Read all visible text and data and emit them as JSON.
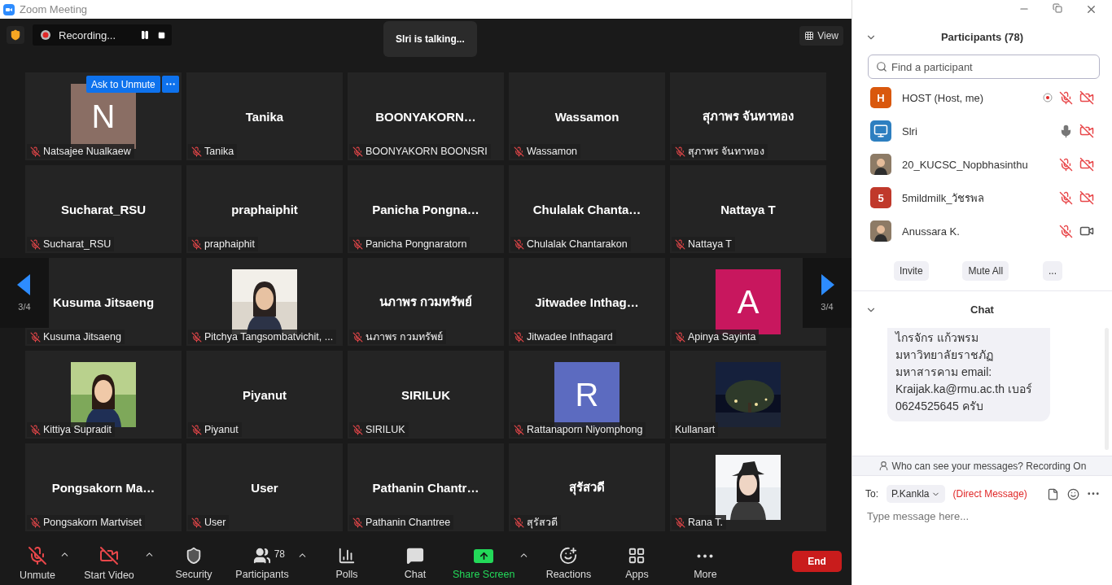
{
  "window": {
    "title": "Zoom Meeting"
  },
  "top_bar": {
    "recording": "Recording...",
    "talking": "Slri is talking...",
    "view_button": "View"
  },
  "tiles": [
    {
      "kind": "letter",
      "letter": "N",
      "color": "#8a6e64",
      "name": "Natsajee Nualkaew",
      "muted": true,
      "hover": {
        "ask_button": "Ask to Unmute"
      }
    },
    {
      "kind": "name",
      "display": "Tanika",
      "name": "Tanika",
      "muted": true
    },
    {
      "kind": "name",
      "display": "BOONYAKORN…",
      "name": "BOONYAKORN BOONSRI",
      "muted": true
    },
    {
      "kind": "name",
      "display": "Wassamon",
      "name": "Wassamon",
      "muted": true
    },
    {
      "kind": "name",
      "display": "สุภาพร จันทาทอง",
      "name": "สุภาพร จันทาทอง",
      "muted": true
    },
    {
      "kind": "name",
      "display": "Sucharat_RSU",
      "name": "Sucharat_RSU",
      "muted": true
    },
    {
      "kind": "name",
      "display": "praphaiphit",
      "name": "praphaiphit",
      "muted": true
    },
    {
      "kind": "name",
      "display": "Panicha  Pongna…",
      "name": "Panicha Pongnaratorn",
      "muted": true
    },
    {
      "kind": "name",
      "display": "Chulalak  Chanta…",
      "name": "Chulalak Chantarakon",
      "muted": true
    },
    {
      "kind": "name",
      "display": "Nattaya T",
      "name": "Nattaya T",
      "muted": true
    },
    {
      "kind": "name",
      "display": "Kusuma Jitsaeng",
      "name": "Kusuma Jitsaeng",
      "muted": true
    },
    {
      "kind": "picture",
      "name": "Pitchya Tangsombatvichit, ...",
      "muted": true
    },
    {
      "kind": "name",
      "display": "นภาพร กวมทรัพย์",
      "name": "นภาพร กวมทรัพย์",
      "muted": true
    },
    {
      "kind": "name",
      "display": "Jitwadee  Inthag…",
      "name": "Jitwadee Inthagard",
      "muted": true
    },
    {
      "kind": "letter",
      "letter": "A",
      "color": "#c8175e",
      "name": "Apinya Sayinta",
      "muted": true
    },
    {
      "kind": "picture",
      "name": "Kittiya Supradit",
      "muted": true
    },
    {
      "kind": "name",
      "display": "Piyanut",
      "name": "Piyanut",
      "muted": true
    },
    {
      "kind": "name",
      "display": "SIRILUK",
      "name": "SIRILUK",
      "muted": true
    },
    {
      "kind": "letter",
      "letter": "R",
      "color": "#5c6bc0",
      "name": "Rattanaporn Niyomphong",
      "muted": true
    },
    {
      "kind": "picture",
      "name": "Kullanart",
      "muted": false
    },
    {
      "kind": "name",
      "display": "Pongsakorn  Ma…",
      "name": "Pongsakorn Martviset",
      "muted": true
    },
    {
      "kind": "name",
      "display": "User",
      "name": "User",
      "muted": true
    },
    {
      "kind": "name",
      "display": "Pathanin  Chantr…",
      "name": "Pathanin Chantree",
      "muted": true
    },
    {
      "kind": "name",
      "display": "สุรัสวดี",
      "name": "สุรัสวดี",
      "muted": true
    },
    {
      "kind": "picture",
      "name": "Rana T.",
      "muted": true
    }
  ],
  "pager": {
    "left": "3/4",
    "right": "3/4"
  },
  "toolbar": [
    {
      "kind": "mic_off",
      "label": "Unmute",
      "caret": true
    },
    {
      "kind": "video_off",
      "label": "Start Video",
      "caret": true
    },
    {
      "kind": "security",
      "label": "Security",
      "caret": false
    },
    {
      "kind": "participants",
      "label": "Participants",
      "badge": "78",
      "caret": true
    },
    {
      "kind": "polls",
      "label": "Polls",
      "caret": false
    },
    {
      "kind": "chat",
      "label": "Chat",
      "caret": false
    },
    {
      "kind": "share",
      "label": "Share Screen",
      "caret": true
    },
    {
      "kind": "reactions",
      "label": "Reactions",
      "caret": false
    },
    {
      "kind": "apps",
      "label": "Apps",
      "caret": false
    },
    {
      "kind": "more",
      "label": "More",
      "caret": false
    }
  ],
  "end_button": "End",
  "participants_panel": {
    "title": "Participants (78)",
    "search": {
      "placeholder": "Find a participant"
    },
    "list": [
      {
        "name": "HOST (Host, me)",
        "avatar": {
          "kind": "letter",
          "letter": "H",
          "color": "#d9580d"
        },
        "recording": true,
        "muted": true,
        "video_on": false
      },
      {
        "name": "Slri",
        "avatar": {
          "kind": "device",
          "color": "#2d7fc0"
        },
        "recording": false,
        "muted": false,
        "video_on": false
      },
      {
        "name": "20_KUCSC_Nopbhasinthu",
        "recording": false,
        "muted": true,
        "video_on": false
      },
      {
        "name": "5mildmilk_วัชรพล",
        "avatar": {
          "kind": "letter",
          "letter": "5",
          "color": "#c0392b"
        },
        "recording": false,
        "muted": true,
        "video_on": false
      },
      {
        "name": "Anussara K.",
        "recording": false,
        "muted": true,
        "video_on": true
      }
    ],
    "buttons": [
      "Invite",
      "Mute All",
      "..."
    ]
  },
  "chat": {
    "title": "Chat",
    "message": "ไกรจักร แก้วพรม มหาวิทยาลัยราชภัฏ มหาสารคาม email: Kraijak.ka@rmu.ac.th เบอร์ 0624525645 ครับ",
    "notice": "Who can see your messages? Recording On",
    "to_label": "To:",
    "recipient": "P.Kankla",
    "direct": "(Direct Message)",
    "input": {
      "placeholder": "Type message here..."
    }
  }
}
